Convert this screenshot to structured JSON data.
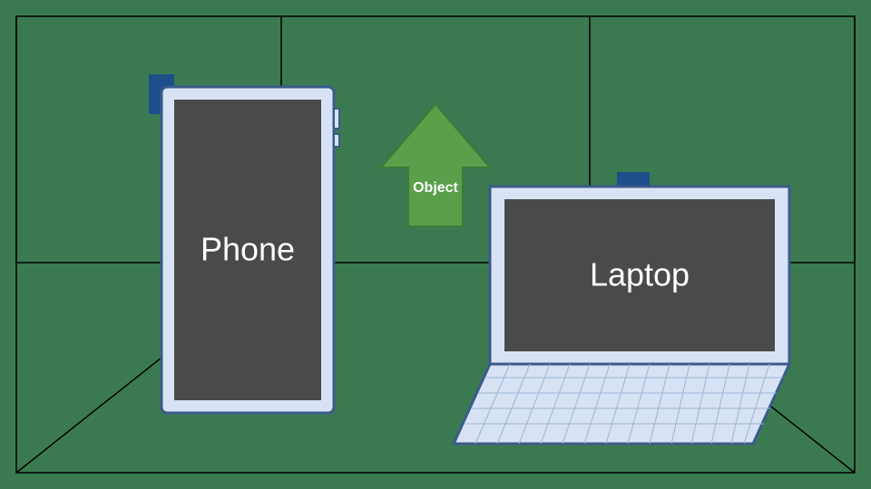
{
  "diagram": {
    "background_color": "#3b7a51",
    "room_stroke": "#000000",
    "phone": {
      "label": "Phone",
      "body_fill": "#d7e3f4",
      "body_stroke": "#3b5a8a",
      "screen_fill": "#4a4a4a",
      "accent_fill": "#1c4f8b"
    },
    "laptop": {
      "label": "Laptop",
      "body_fill": "#d7e3f4",
      "body_stroke": "#3b5a8a",
      "screen_fill": "#4a4a4a",
      "accent_fill": "#1c4f8b"
    },
    "arrow": {
      "label": "Object",
      "fill": "#5aa04b",
      "stroke": "#3f7a36"
    }
  }
}
